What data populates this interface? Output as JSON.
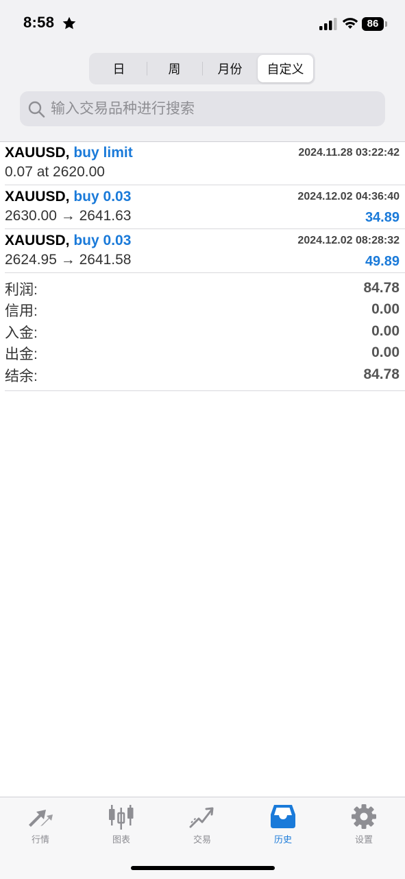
{
  "status_bar": {
    "time": "8:58",
    "battery": "86"
  },
  "period_tabs": [
    {
      "label": "日",
      "active": false
    },
    {
      "label": "周",
      "active": false
    },
    {
      "label": "月份",
      "active": false
    },
    {
      "label": "自定义",
      "active": true
    }
  ],
  "search": {
    "placeholder": "输入交易品种进行搜索"
  },
  "orders": [
    {
      "symbol": "XAUUSD,",
      "direction": "buy limit",
      "time": "2024.11.28 03:22:42",
      "detail": "0.07 at 2620.00",
      "profit": ""
    },
    {
      "symbol": "XAUUSD,",
      "direction": "buy 0.03",
      "time": "2024.12.02 04:36:40",
      "detail": "2630.00 → 2641.63",
      "profit": "34.89"
    },
    {
      "symbol": "XAUUSD,",
      "direction": "buy 0.03",
      "time": "2024.12.02 08:28:32",
      "detail": "2624.95 → 2641.58",
      "profit": "49.89"
    }
  ],
  "summary": [
    {
      "label": "利润:",
      "value": "84.78"
    },
    {
      "label": "信用:",
      "value": "0.00"
    },
    {
      "label": "入金:",
      "value": "0.00"
    },
    {
      "label": "出金:",
      "value": "0.00"
    },
    {
      "label": "结余:",
      "value": "84.78"
    }
  ],
  "tabs": [
    {
      "label": "行情",
      "icon": "quotes-arrows-icon",
      "active": false
    },
    {
      "label": "图表",
      "icon": "candlestick-chart-icon",
      "active": false
    },
    {
      "label": "交易",
      "icon": "trade-trend-icon",
      "active": false
    },
    {
      "label": "历史",
      "icon": "history-inbox-icon",
      "active": true
    },
    {
      "label": "设置",
      "icon": "gear-icon",
      "active": false
    }
  ],
  "colors": {
    "accent": "#1a7ad9",
    "inactive_tab": "#8e8e93",
    "background_top": "#f2f2f4"
  }
}
